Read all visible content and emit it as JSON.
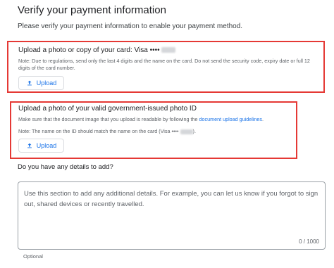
{
  "header": {
    "title": "Verify your payment information",
    "subtitle": "Please verify your payment information to enable your payment method."
  },
  "card_upload": {
    "heading": "Upload a photo or copy of your card: Visa ••••",
    "note": "Note: Due to regulations, send only the last 4 digits and the name on the card. Do not send the security code, expiry date or full 12 digits of the card number.",
    "upload_label": "Upload"
  },
  "id_upload": {
    "heading": "Upload a photo of your valid government-issued photo ID",
    "note_prefix": "Make sure that the document image that you upload is readable by following the ",
    "note_link": "document upload guidelines",
    "note_suffix": ".",
    "name_note_prefix": "Note: The name on the ID should match the name on the card (Visa ••••",
    "name_note_suffix": ").",
    "upload_label": "Upload"
  },
  "details": {
    "label": "Do you have any details to add?",
    "placeholder": "Use this section to add any additional details. For example, you can let us know if you forgot to sign out, shared devices or recently travelled.",
    "counter": "0 / 1000",
    "optional": "Optional"
  },
  "colors": {
    "highlight_border": "#e53935",
    "accent": "#1a73e8"
  }
}
